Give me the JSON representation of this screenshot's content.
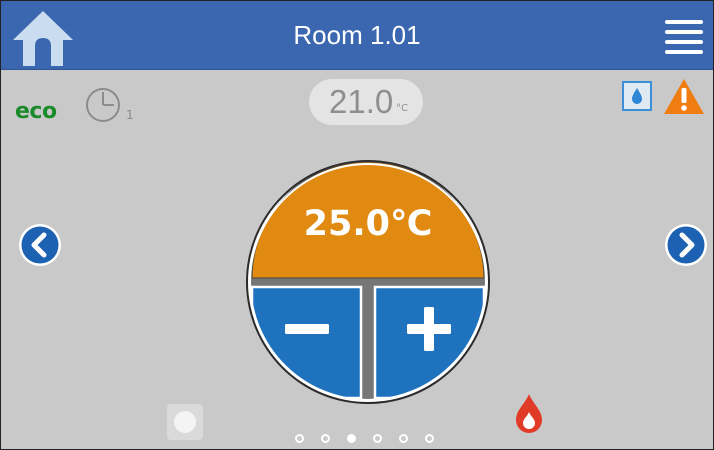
{
  "header": {
    "title": "Room 1.01",
    "home_icon": "home-icon",
    "menu_icon": "hamburger-menu-icon",
    "bar_color": "#3b67b0"
  },
  "status": {
    "eco_label": "eco",
    "schedule_icon": "clock-icon",
    "schedule_number": "1",
    "setpoint_value": "21.0",
    "setpoint_unit": "°C",
    "humidity_icon": "water-drop-icon",
    "warning_icon": "warning-icon",
    "warning_color": "#f07d12"
  },
  "dial": {
    "temperature": "25.0℃",
    "decrease_icon": "minus-icon",
    "increase_icon": "plus-icon",
    "top_color": "#e18a12",
    "button_color": "#1e72be"
  },
  "navigation": {
    "prev_icon": "chevron-left-icon",
    "next_icon": "chevron-right-icon"
  },
  "footer": {
    "heating_icon": "flame-icon",
    "heating_color": "#e13b28",
    "page_count": 6,
    "active_page": 3
  }
}
